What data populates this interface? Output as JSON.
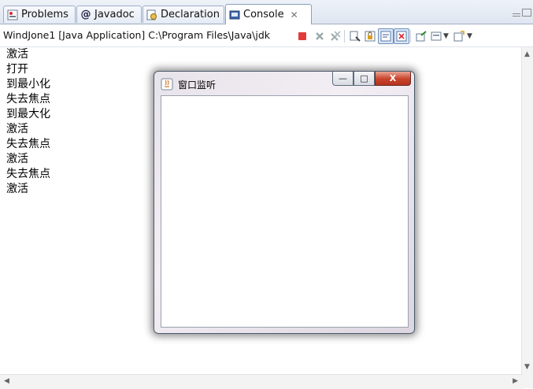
{
  "tabs": [
    {
      "label": "Problems",
      "icon": "problems-icon"
    },
    {
      "label": "Javadoc",
      "icon": "at-icon"
    },
    {
      "label": "Declaration",
      "icon": "declaration-icon"
    },
    {
      "label": "Console",
      "icon": "console-icon",
      "active": true,
      "close": "✕"
    }
  ],
  "toolbar": {
    "process_name": "WindJone1 [Java Application] C:\\Program Files\\Java\\jdk"
  },
  "console": {
    "lines": [
      "激活",
      "打开",
      "到最小化",
      "失去焦点",
      "到最大化",
      "激活",
      "失去焦点",
      "激活",
      "失去焦点",
      "激活"
    ]
  },
  "window": {
    "title": "窗口监听",
    "minimize": "—",
    "maximize": "□",
    "close": "X"
  },
  "colors": {
    "terminate": "#e03a3a",
    "tab_border": "#9fb0c9",
    "close_button": "#c9422a"
  }
}
